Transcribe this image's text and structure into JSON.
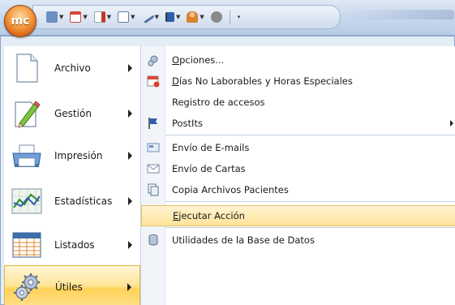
{
  "app": {
    "orb_text": "mc"
  },
  "quick_access": {
    "buttons": [
      {
        "icon": "notes-icon",
        "color": "#6d8fc2"
      },
      {
        "icon": "calendar-icon",
        "color": "#d8463b"
      },
      {
        "icon": "document-red-icon",
        "color": "#c0392b"
      },
      {
        "icon": "document-icon",
        "color": "#5a7fb0"
      },
      {
        "icon": "pen-icon",
        "color": "#4d6fa0"
      },
      {
        "icon": "flag-icon",
        "color": "#2f5fb3"
      },
      {
        "icon": "person-icon",
        "color": "#d9822b"
      },
      {
        "icon": "tools-icon",
        "color": "#777777"
      }
    ]
  },
  "left_menu": {
    "items": [
      {
        "label": "Archivo",
        "icon": "document-icon",
        "has_submenu": true,
        "selected": false
      },
      {
        "label": "Gestión",
        "icon": "pencil-icon",
        "has_submenu": true,
        "selected": false
      },
      {
        "label": "Impresión",
        "icon": "printer-icon",
        "has_submenu": true,
        "selected": false
      },
      {
        "label": "Estadísticas",
        "icon": "chart-icon",
        "has_submenu": true,
        "selected": false
      },
      {
        "label": "Listados",
        "icon": "list-icon",
        "has_submenu": true,
        "selected": false
      },
      {
        "label": "Útiles",
        "icon": "gears-icon",
        "has_submenu": true,
        "selected": true
      }
    ]
  },
  "submenu": {
    "items": [
      {
        "label": "Opciones...",
        "access_key": "O",
        "icon": "gear-icon"
      },
      {
        "label": "Días No Laborables y Horas Especiales",
        "access_key": "D",
        "icon": "calendar-icon"
      },
      {
        "label": "Registro de accesos",
        "icon": ""
      },
      {
        "label": "PostIts",
        "icon": "flag-icon",
        "has_submenu": true
      },
      {
        "label": "Envío de E-mails",
        "icon": "email-icon"
      },
      {
        "label": "Envío de Cartas",
        "icon": "envelope-icon"
      },
      {
        "label": "Copia Archivos Pacientes",
        "icon": "copy-icon"
      },
      {
        "label": "Ejecutar Acción",
        "access_key": "E",
        "icon": "",
        "highlighted": true
      },
      {
        "label": "Utilidades de la Base de Datos",
        "icon": "database-icon"
      }
    ]
  }
}
